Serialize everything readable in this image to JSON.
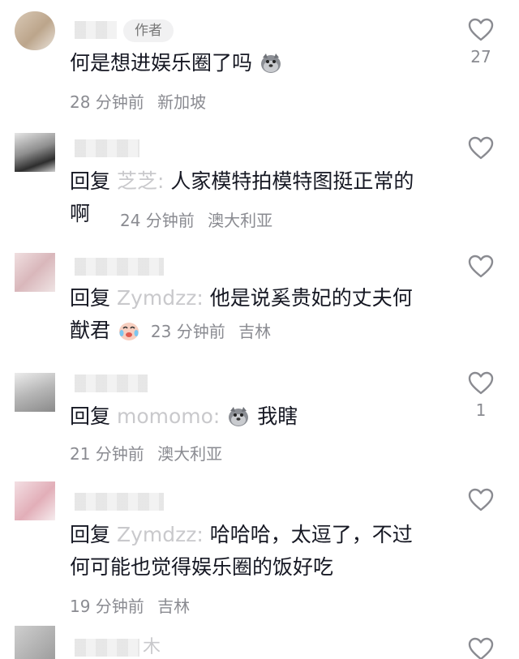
{
  "comments": [
    {
      "username": "",
      "author_tag": "作者",
      "text": "何是想进娱乐圈了吗",
      "emoji": "dog-icon",
      "time": "28 分钟前",
      "location": "新加坡",
      "likes": "27"
    },
    {
      "reply_prefix": "回复",
      "reply_to": "芝芝:",
      "text": "人家模特拍模特图挺正常的啊",
      "time": "24 分钟前",
      "location": "澳大利亚",
      "likes": ""
    },
    {
      "reply_prefix": "回复",
      "reply_to": "Zymdzz:",
      "text": "他是说奚贵妃的丈夫何猷君",
      "emoji": "crying-laughing-icon",
      "time": "23 分钟前",
      "location": "吉林",
      "likes": ""
    },
    {
      "reply_prefix": "回复",
      "reply_to": "momomo:",
      "text": "我瞎",
      "emoji": "dog-icon",
      "time": "21 分钟前",
      "location": "澳大利亚",
      "likes": "1"
    },
    {
      "reply_prefix": "回复",
      "reply_to": "Zymdzz:",
      "text": "哈哈哈，太逗了，不过何可能也觉得娱乐圈的饭好吃",
      "time": "19 分钟前",
      "location": "吉林",
      "likes": ""
    },
    {
      "username": "木",
      "likes": ""
    }
  ]
}
